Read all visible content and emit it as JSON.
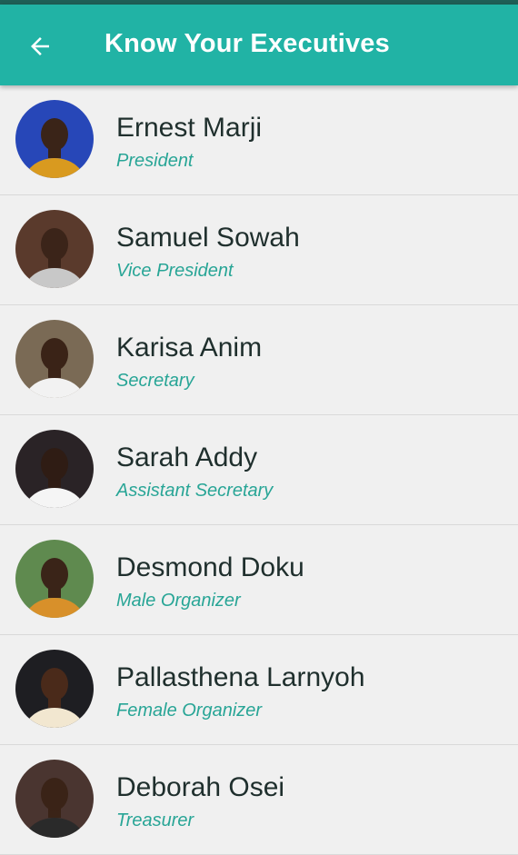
{
  "appbar": {
    "title": "Know Your Executives",
    "back_icon": "arrow-back-icon"
  },
  "colors": {
    "appbar": "#21b3a5",
    "statusbar": "#1f5f57",
    "role_text": "#28a596",
    "name_text": "#1f2f2d",
    "background": "#f0f0f0"
  },
  "executives": [
    {
      "name": "Ernest Marji",
      "role": "President",
      "avatar": {
        "bg": "#2747b8",
        "skin": "#3a2418",
        "shirt": "#d99a1f"
      }
    },
    {
      "name": "Samuel Sowah",
      "role": "Vice President",
      "avatar": {
        "bg": "#5a3a2c",
        "skin": "#3b2419",
        "shirt": "#c8c8c8"
      }
    },
    {
      "name": "Karisa Anim",
      "role": "Secretary",
      "avatar": {
        "bg": "#7a6a55",
        "skin": "#3a2317",
        "shirt": "#f2f2f2"
      }
    },
    {
      "name": "Sarah Addy",
      "role": "Assistant Secretary",
      "avatar": {
        "bg": "#2a2326",
        "skin": "#2f1c14",
        "shirt": "#f5f5f5"
      }
    },
    {
      "name": "Desmond Doku",
      "role": "Male Organizer",
      "avatar": {
        "bg": "#5f8a4f",
        "skin": "#3a2418",
        "shirt": "#d8902a"
      }
    },
    {
      "name": "Pallasthena Larnyoh",
      "role": "Female Organizer",
      "avatar": {
        "bg": "#1e1e22",
        "skin": "#4a2a1a",
        "shirt": "#f2e7d0"
      }
    },
    {
      "name": "Deborah Osei",
      "role": "Treasurer",
      "avatar": {
        "bg": "#4a3530",
        "skin": "#3a2317",
        "shirt": "#2a2a2a"
      }
    }
  ]
}
